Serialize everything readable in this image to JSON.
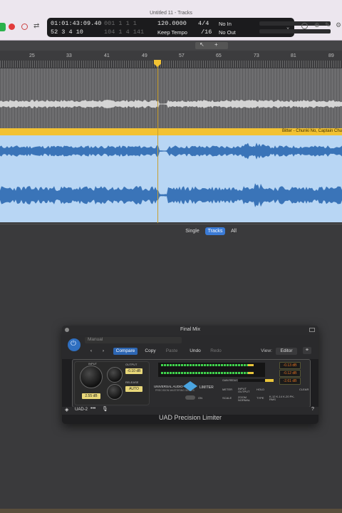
{
  "window": {
    "title": "Untitled 11 - Tracks"
  },
  "lcd": {
    "time": "01:01:43:09.40",
    "time_ghost": "001  1  1  1",
    "bars": "52  3  4    10",
    "bars_ghost": "104  1  4  141",
    "tempo": "120.0000",
    "tempo_mode": "Keep Tempo",
    "signature_top": "4/4",
    "signature_bottom": "/16",
    "input": "No In",
    "output": "No Out"
  },
  "ruler": {
    "bars": [
      "25",
      "33",
      "41",
      "49",
      "57",
      "65",
      "73",
      "81",
      "89"
    ]
  },
  "tracks": {
    "region_name": "Bitter - Chunki No, Captain Chu"
  },
  "view_selector": {
    "single": "Single",
    "tracks": "Tracks",
    "all": "All"
  },
  "plugin": {
    "window_title": "Final Mix",
    "preset": "Manual",
    "compare": "Compare",
    "copy": "Copy",
    "paste": "Paste",
    "undo": "Undo",
    "redo": "Redo",
    "view_label": "View:",
    "view_value": "Editor",
    "name": "UAD Precision Limiter",
    "uad_label": "UAD-2",
    "input_label": "INPUT",
    "output_label": "OUTPUT",
    "output_value": "-0.10 dB",
    "release_label": "RELEASE",
    "release_value": "AUTO",
    "input_value": "2.55 dB",
    "brand": "UNIVERSAL AUDIO",
    "brand_sub": "PRECISION MASTERING SERIES",
    "limiter_label": "LIMITER",
    "peak_l": "-0.13 dB",
    "peak_r": "-0.12 dB",
    "gain_reduction": "-2.61 dB",
    "gain_reduction_label": "GAIN REDUCTION",
    "meter_label": "METER",
    "meter_value": "INPUT OUTPUT",
    "scale_label": "SCALE",
    "scale_value": "ZOOM NORMAL",
    "hold_label": "HOLD",
    "clear_label": "CLEAR",
    "type_label": "TYPE",
    "type_value": "K-12 K-14 K-20 PK-RMS",
    "on_label": "ON",
    "help": "?"
  }
}
